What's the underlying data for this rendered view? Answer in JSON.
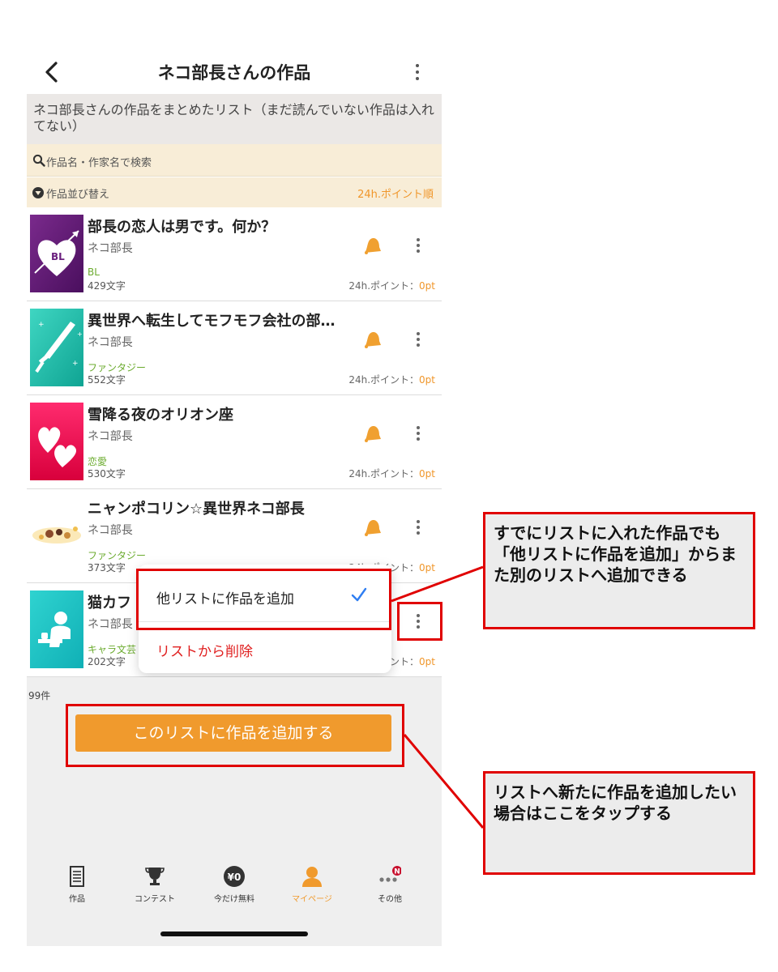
{
  "header": {
    "title": "ネコ部長さんの作品"
  },
  "description": "ネコ部長さんの作品をまとめたリスト（まだ読んでいない作品は入れてない）",
  "search": {
    "placeholder": "作品名・作家名で検索"
  },
  "sort": {
    "label": "作品並び替え",
    "value": "24h.ポイント順"
  },
  "works": [
    {
      "title": "部長の恋人は男です。何か？",
      "author": "ネコ部長",
      "genre": "BL",
      "chars": "429文字",
      "points_label": "24h.ポイント：",
      "points_value": "0pt"
    },
    {
      "title": "異世界へ転生してモフモフ会社の部…",
      "author": "ネコ部長",
      "genre": "ファンタジー",
      "chars": "552文字",
      "points_label": "24h.ポイント：",
      "points_value": "0pt"
    },
    {
      "title": "雪降る夜のオリオン座",
      "author": "ネコ部長",
      "genre": "恋愛",
      "chars": "530文字",
      "points_label": "24h.ポイント：",
      "points_value": "0pt"
    },
    {
      "title": "ニャンポコリン☆異世界ネコ部長",
      "author": "ネコ部長",
      "genre": "ファンタジー",
      "chars": "373文字",
      "points_label": "24h.ポイント：",
      "points_value": "0pt"
    },
    {
      "title": "猫カフ",
      "author": "ネコ部長",
      "genre": "キャラ文芸",
      "chars": "202文字",
      "points_label": "ント：",
      "points_value": "0pt"
    }
  ],
  "context_menu": {
    "add_to_other_list": "他リストに作品を追加",
    "remove_from_list": "リストから削除"
  },
  "count": "99件",
  "add_button": "このリストに作品を追加する",
  "tabs": [
    {
      "label": "作品",
      "icon": "document-icon"
    },
    {
      "label": "コンテスト",
      "icon": "trophy-icon"
    },
    {
      "label": "今だけ無料",
      "icon": "yen-coin-icon",
      "badge_text": "¥0"
    },
    {
      "label": "マイページ",
      "icon": "person-icon"
    },
    {
      "label": "その他",
      "icon": "more-dots-icon",
      "badge_text": "N"
    }
  ],
  "annotations": {
    "note_top": "すでにリストに入れた作品でも「他リストに作品を追加」からまた別のリストへ追加できる",
    "note_bottom": "リストへ新たに作品を追加したい場合はここをタップする"
  },
  "colors": {
    "accent": "#f09a2d",
    "highlight": "#e00000",
    "genre": "#6bab2e"
  }
}
